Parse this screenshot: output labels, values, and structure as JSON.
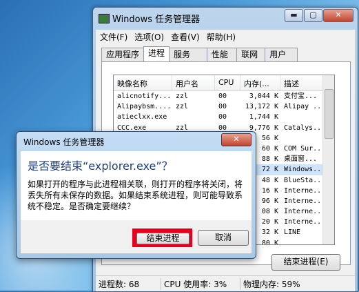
{
  "task_manager": {
    "title": "Windows 任务管理器",
    "window_buttons": {
      "minimize": "▬",
      "maximize": "▢",
      "close": "✕"
    },
    "menu": [
      "文件(F)",
      "选项(O)",
      "查看(V)",
      "帮助(H)"
    ],
    "tabs": [
      "应用程序",
      "进程",
      "服务",
      "性能",
      "联网",
      "用户"
    ],
    "active_tab": "进程",
    "columns": [
      "映像名称",
      "用户名",
      "CPU",
      "内存(...",
      "描述"
    ],
    "rows": [
      [
        "alicnotify...",
        "zzl",
        "00",
        "3,044 K",
        "支付宝..."
      ],
      [
        "Alipaybsm....",
        "zzl",
        "00",
        "13,172 K",
        "Alipay ..."
      ],
      [
        "atieclxx.exe",
        "",
        "00",
        "1,744 K",
        ""
      ],
      [
        "CCC.exe",
        "zzl",
        "00",
        "9,776 K",
        "Catalys..."
      ],
      [
        "",
        "",
        "",
        "56 K",
        ""
      ],
      [
        "",
        "",
        "",
        "60 K",
        "COM Sur..."
      ],
      [
        "",
        "",
        "",
        "88 K",
        "桌面窗..."
      ],
      [
        "",
        "",
        "",
        "72 K",
        "Windows..."
      ],
      [
        "",
        "",
        "",
        "48 K",
        "BlueSta..."
      ],
      [
        "",
        "",
        "",
        "16 K",
        "Interne..."
      ],
      [
        "",
        "",
        "",
        "96 K",
        "Interne..."
      ],
      [
        "",
        "",
        "",
        "08 K",
        "Interne..."
      ],
      [
        "",
        "",
        "",
        "20 K",
        "Interne..."
      ],
      [
        "",
        "",
        "",
        "32 K",
        "LINE"
      ],
      [
        "",
        "",
        "",
        "80 K",
        ""
      ]
    ],
    "selected_row": 7,
    "end_process_button": "结束进程(E)",
    "status": {
      "processes": "进程数: 68",
      "cpu": "CPU 使用率: 3%",
      "memory": "物理内存: 59%"
    }
  },
  "dialog": {
    "title": "Windows 任务管理器",
    "close": "✕",
    "heading": "是否要结束“explorer.exe”？",
    "message": "如果打开的程序与此进程相关联，则打开的程序将关闭，将丢失所有未保存的数据。如果结束系统进程，则可能导致系统不稳定。是否确定要继续？",
    "confirm_button": "结束进程",
    "cancel_button": "取消"
  }
}
